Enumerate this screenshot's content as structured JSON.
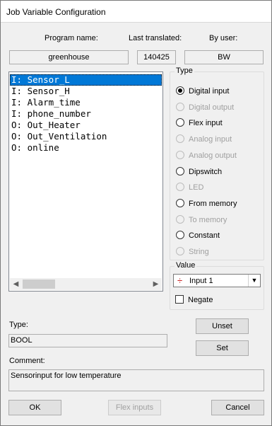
{
  "window": {
    "title": "Job Variable Configuration"
  },
  "header": {
    "program_name_label": "Program name:",
    "last_translated_label": "Last translated:",
    "by_user_label": "By user:",
    "program_name": "greenhouse",
    "last_translated": "140425",
    "by_user": "BW"
  },
  "variables": [
    {
      "text": "I: Sensor_L",
      "selected": true
    },
    {
      "text": "I: Sensor_H",
      "selected": false
    },
    {
      "text": "I: Alarm_time",
      "selected": false
    },
    {
      "text": "I: phone_number",
      "selected": false
    },
    {
      "text": "O: Out_Heater",
      "selected": false
    },
    {
      "text": "O: Out_Ventilation",
      "selected": false
    },
    {
      "text": "O: online",
      "selected": false
    }
  ],
  "type_group": {
    "label": "Type",
    "options": [
      {
        "label": "Digital input",
        "checked": true,
        "enabled": true
      },
      {
        "label": "Digital output",
        "checked": false,
        "enabled": false
      },
      {
        "label": "Flex input",
        "checked": false,
        "enabled": true
      },
      {
        "label": "Analog input",
        "checked": false,
        "enabled": false
      },
      {
        "label": "Analog output",
        "checked": false,
        "enabled": false
      },
      {
        "label": "Dipswitch",
        "checked": false,
        "enabled": true
      },
      {
        "label": "LED",
        "checked": false,
        "enabled": false
      },
      {
        "label": "From memory",
        "checked": false,
        "enabled": true
      },
      {
        "label": "To memory",
        "checked": false,
        "enabled": false
      },
      {
        "label": "Constant",
        "checked": false,
        "enabled": true
      },
      {
        "label": "String",
        "checked": false,
        "enabled": false
      }
    ]
  },
  "value_group": {
    "label": "Value",
    "selected": "Input 1",
    "icon": "input-terminal-icon",
    "negate_label": "Negate",
    "negate_checked": false
  },
  "details": {
    "type_label": "Type:",
    "type_value": "BOOL",
    "comment_label": "Comment:",
    "comment_value": "Sensorinput for low temperature"
  },
  "buttons": {
    "unset": "Unset",
    "set": "Set",
    "ok": "OK",
    "flex_inputs": "Flex inputs",
    "cancel": "Cancel"
  }
}
